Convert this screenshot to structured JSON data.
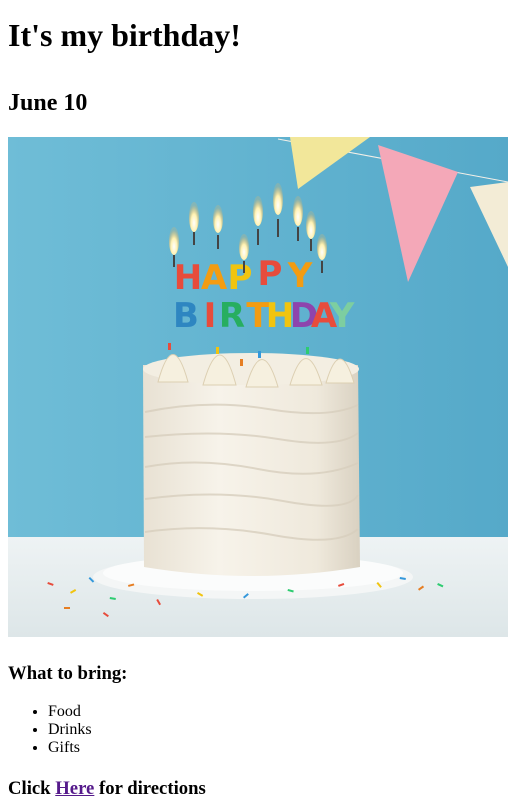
{
  "title": "It's my birthday!",
  "date": "June 10",
  "image": {
    "alt": "Birthday cake with candles",
    "colors": {
      "wall": "#5fb0cf",
      "table": "#e9eef0",
      "frosting": "#f4efe3"
    }
  },
  "bring": {
    "heading": "What to bring:",
    "items": [
      "Food",
      "Drinks",
      "Gifts"
    ]
  },
  "directions": {
    "prefix": "Click ",
    "link_label": "Here",
    "suffix": " for directions"
  }
}
